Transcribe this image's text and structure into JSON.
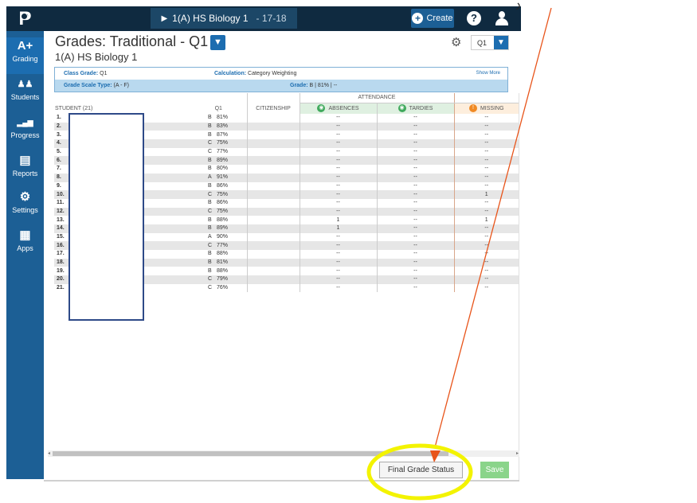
{
  "topbar": {
    "class_selector": "1(A) HS Biology 1",
    "term": "- 17-18",
    "create_label": "Create",
    "help_label": "?"
  },
  "sidenav": {
    "items": [
      {
        "label": "Grading",
        "icon": "A+"
      },
      {
        "label": "Students",
        "icon": "students-icon"
      },
      {
        "label": "Progress",
        "icon": "bar-chart-icon"
      },
      {
        "label": "Reports",
        "icon": "reports-icon"
      },
      {
        "label": "Settings",
        "icon": "gear-icon"
      },
      {
        "label": "Apps",
        "icon": "grid-icon"
      }
    ]
  },
  "header": {
    "title": "Grades: Traditional - Q1",
    "subtitle": "1(A) HS Biology 1",
    "term_select": "Q1"
  },
  "info": {
    "class_grade_label": "Class Grade:",
    "class_grade_value": "Q1",
    "calculation_label": "Calculation:",
    "calculation_value": "Category Weighting",
    "show_more": "Show More",
    "grade_scale_label": "Grade Scale Type:",
    "grade_scale_value": "(A - F)",
    "grade_label": "Grade:",
    "grade_value": "B",
    "grade_pct": "81%",
    "grade_sep": "|",
    "grade_extra": "--"
  },
  "table": {
    "attendance_header": "ATTENDANCE",
    "student_header": "STUDENT (21)",
    "q1_header": "Q1",
    "citizenship_header": "CITIZENSHIP",
    "absences_header": "ABSENCES",
    "tardies_header": "TARDIES",
    "missing_header": "MISSING",
    "rows": [
      {
        "num": "1.",
        "grade": "B",
        "pct": "81%",
        "abs": "--",
        "tar": "--",
        "mis": "--"
      },
      {
        "num": "2.",
        "grade": "B",
        "pct": "83%",
        "abs": "--",
        "tar": "--",
        "mis": "--"
      },
      {
        "num": "3.",
        "grade": "B",
        "pct": "87%",
        "abs": "--",
        "tar": "--",
        "mis": "--"
      },
      {
        "num": "4.",
        "grade": "C",
        "pct": "75%",
        "abs": "--",
        "tar": "--",
        "mis": "--"
      },
      {
        "num": "5.",
        "grade": "C",
        "pct": "77%",
        "abs": "--",
        "tar": "--",
        "mis": "--"
      },
      {
        "num": "6.",
        "grade": "B",
        "pct": "89%",
        "abs": "--",
        "tar": "--",
        "mis": "--"
      },
      {
        "num": "7.",
        "grade": "B",
        "pct": "80%",
        "abs": "--",
        "tar": "--",
        "mis": "--"
      },
      {
        "num": "8.",
        "grade": "A",
        "pct": "91%",
        "abs": "--",
        "tar": "--",
        "mis": "--"
      },
      {
        "num": "9.",
        "grade": "B",
        "pct": "86%",
        "abs": "--",
        "tar": "--",
        "mis": "--"
      },
      {
        "num": "10.",
        "grade": "C",
        "pct": "75%",
        "abs": "--",
        "tar": "--",
        "mis": "1"
      },
      {
        "num": "11.",
        "grade": "B",
        "pct": "86%",
        "abs": "--",
        "tar": "--",
        "mis": "--"
      },
      {
        "num": "12.",
        "grade": "C",
        "pct": "75%",
        "abs": "--",
        "tar": "--",
        "mis": "--"
      },
      {
        "num": "13.",
        "grade": "B",
        "pct": "88%",
        "abs": "1",
        "tar": "--",
        "mis": "1"
      },
      {
        "num": "14.",
        "grade": "B",
        "pct": "89%",
        "abs": "1",
        "tar": "--",
        "mis": "--"
      },
      {
        "num": "15.",
        "grade": "A",
        "pct": "90%",
        "abs": "--",
        "tar": "--",
        "mis": "--"
      },
      {
        "num": "16.",
        "grade": "C",
        "pct": "77%",
        "abs": "--",
        "tar": "--",
        "mis": "--"
      },
      {
        "num": "17.",
        "grade": "B",
        "pct": "88%",
        "abs": "--",
        "tar": "--",
        "mis": "--"
      },
      {
        "num": "18.",
        "grade": "B",
        "pct": "81%",
        "abs": "--",
        "tar": "--",
        "mis": "--"
      },
      {
        "num": "19.",
        "grade": "B",
        "pct": "88%",
        "abs": "--",
        "tar": "--",
        "mis": "--"
      },
      {
        "num": "20.",
        "grade": "C",
        "pct": "79%",
        "abs": "--",
        "tar": "--",
        "mis": "--"
      },
      {
        "num": "21.",
        "grade": "C",
        "pct": "76%",
        "abs": "--",
        "tar": "--",
        "mis": "--"
      }
    ]
  },
  "footer": {
    "final_grade_status": "Final Grade Status",
    "save": "Save"
  },
  "colors": {
    "topbar": "#0f2a40",
    "sidenav": "#1c5f95",
    "accent": "#1c6db0",
    "save": "#8ad48a",
    "annotation": "#f3f300",
    "arrow": "#e8541a"
  }
}
